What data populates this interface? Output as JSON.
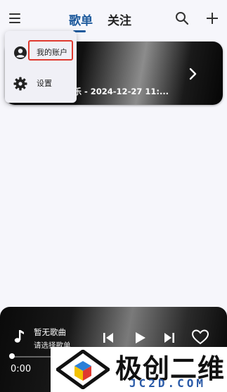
{
  "header": {
    "tabs": [
      {
        "label": "歌单",
        "active": true
      },
      {
        "label": "关注",
        "active": false
      }
    ],
    "accent_color": "#1e5a9c"
  },
  "menu": {
    "items": [
      {
        "label": "我的账户",
        "icon": "account-circle-icon",
        "highlighted": true
      },
      {
        "label": "设置",
        "icon": "gear-icon",
        "highlighted": false
      }
    ],
    "highlight_color": "#e03a2f"
  },
  "playlist": {
    "title_visible": "音乐 - 2024-12-27 11:..."
  },
  "player": {
    "song_title": "暂无歌曲",
    "song_subtitle": "请选择歌单",
    "current_time": "0:00",
    "progress": 0.0
  },
  "watermark": {
    "text_cn": "极创二维",
    "text_en": "JC2D.COM"
  }
}
